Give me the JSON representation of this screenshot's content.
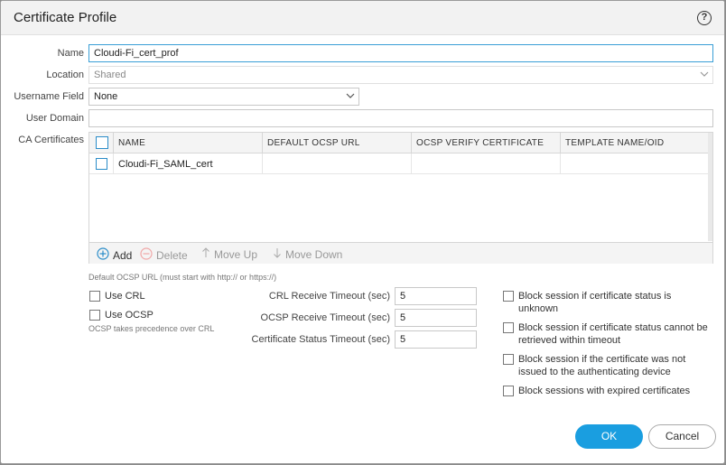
{
  "dialog": {
    "title": "Certificate Profile",
    "help_icon": "?"
  },
  "form": {
    "name": {
      "label": "Name",
      "value": "Cloudi-Fi_cert_prof"
    },
    "location": {
      "label": "Location",
      "value": "Shared"
    },
    "username_field": {
      "label": "Username Field",
      "value": "None"
    },
    "user_domain": {
      "label": "User Domain",
      "value": ""
    },
    "ca_certificates": {
      "label": "CA Certificates"
    }
  },
  "grid": {
    "columns": [
      "NAME",
      "DEFAULT OCSP URL",
      "OCSP VERIFY CERTIFICATE",
      "TEMPLATE NAME/OID"
    ],
    "rows": [
      {
        "name": "Cloudi-Fi_SAML_cert",
        "default_ocsp_url": "",
        "ocsp_verify_certificate": "",
        "template_name_oid": ""
      }
    ],
    "toolbar": {
      "add": "Add",
      "delete": "Delete",
      "move_up": "Move Up",
      "move_down": "Move Down"
    }
  },
  "hints": {
    "ocsp_url": "Default OCSP URL (must start with http:// or https://)",
    "ocsp_precedence": "OCSP takes precedence over CRL"
  },
  "options": {
    "use_crl": {
      "label": "Use CRL",
      "checked": false
    },
    "use_ocsp": {
      "label": "Use OCSP",
      "checked": false
    }
  },
  "timeouts": {
    "crl_receive": {
      "label": "CRL Receive Timeout (sec)",
      "value": "5"
    },
    "ocsp_receive": {
      "label": "OCSP Receive Timeout (sec)",
      "value": "5"
    },
    "cert_status": {
      "label": "Certificate Status Timeout (sec)",
      "value": "5"
    }
  },
  "block": {
    "unknown": {
      "label": "Block session if certificate status is unknown",
      "checked": false
    },
    "timeout": {
      "label": "Block session if certificate status cannot be retrieved within timeout",
      "checked": false
    },
    "not_issued": {
      "label": "Block session if the certificate was not issued to the authenticating device",
      "checked": false
    },
    "expired": {
      "label": "Block sessions with expired certificates",
      "checked": false
    }
  },
  "buttons": {
    "ok": "OK",
    "cancel": "Cancel"
  },
  "colors": {
    "accent": "#1a9ee0",
    "checkbox_blue": "#2a8cc8"
  }
}
